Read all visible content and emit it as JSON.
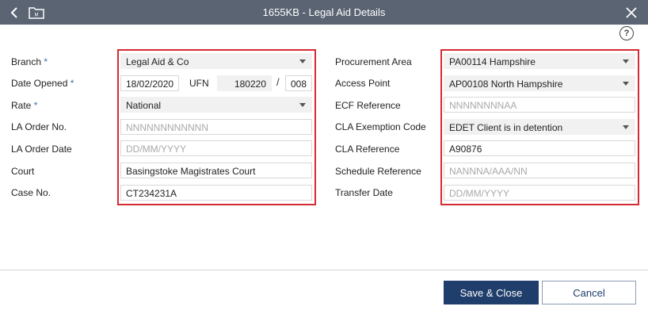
{
  "window": {
    "title": "1655KB - Legal Aid Details"
  },
  "labels": {
    "branch": "Branch",
    "date_opened": "Date Opened",
    "rate": "Rate",
    "la_order_no": "LA Order No.",
    "la_order_date": "LA Order Date",
    "court": "Court",
    "case_no": "Case No.",
    "ufn": "UFN",
    "procurement_area": "Procurement Area",
    "access_point": "Access Point",
    "ecf_reference": "ECF Reference",
    "cla_exemption_code": "CLA Exemption Code",
    "cla_reference": "CLA Reference",
    "schedule_reference": "Schedule Reference",
    "transfer_date": "Transfer Date",
    "required_mark": "*",
    "slash": "/"
  },
  "left": {
    "branch": "Legal Aid & Co",
    "date_opened": "18/02/2020",
    "ufn_part1": "180220",
    "ufn_part2": "008",
    "rate": "National",
    "la_order_no_placeholder": "NNNNNNNNNNNN",
    "la_order_date_placeholder": "DD/MM/YYYY",
    "court": "Basingstoke Magistrates Court",
    "case_no": "CT234231A"
  },
  "right": {
    "procurement_area": "PA00114 Hampshire",
    "access_point": "AP00108 North Hampshire",
    "ecf_reference_placeholder": "NNNNNNNNAA",
    "cla_exemption_code": "EDET Client is in detention",
    "cla_reference": "A90876",
    "schedule_reference_placeholder": "NANNNA/AAA/NN",
    "transfer_date_placeholder": "DD/MM/YYYY"
  },
  "buttons": {
    "save_close": "Save & Close",
    "cancel": "Cancel"
  },
  "icons": {
    "back": "back-arrow-icon",
    "folder": "folder-icon",
    "close": "close-icon",
    "help": "help-icon"
  }
}
